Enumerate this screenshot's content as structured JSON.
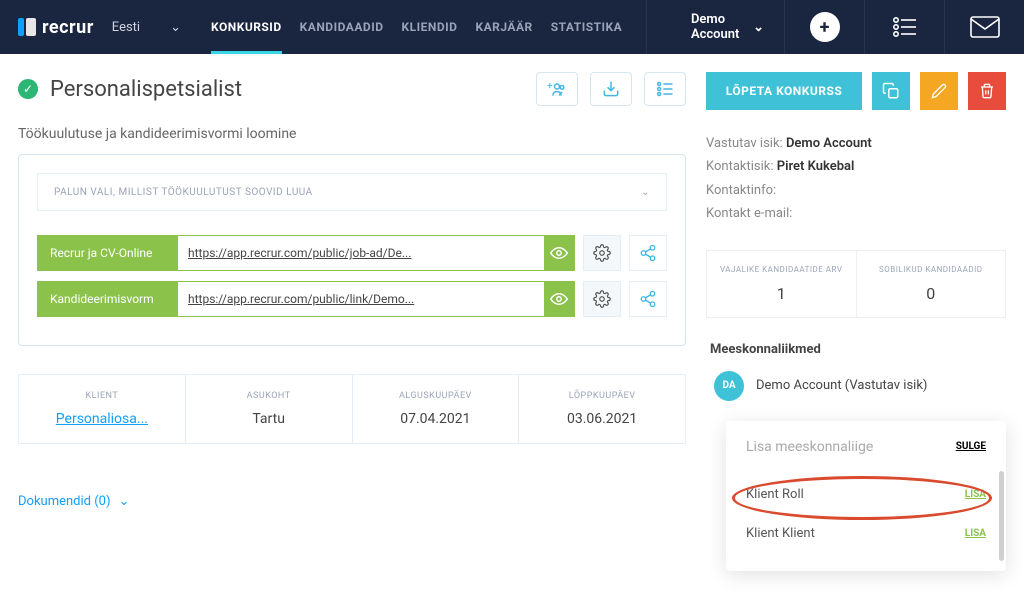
{
  "brand": "recrur",
  "language": "Eesti",
  "nav": {
    "items": [
      "KONKURSID",
      "KANDIDAADID",
      "KLIENDID",
      "KARJÄÄR",
      "STATISTIKA"
    ],
    "active": 0
  },
  "account_name": "Demo Account",
  "page": {
    "title": "Personalispetsialist",
    "section_heading": "Töökuulutuse ja kandideerimisvormi loomine",
    "select_placeholder": "PALUN VALI, MILLIST TÖÖKUULUTUST SOOVID LUUA",
    "links": [
      {
        "label": "Recrur ja CV-Online",
        "url": "https://app.recrur.com/public/job-ad/De..."
      },
      {
        "label": "Kandideerimisvorm",
        "url": "https://app.recrur.com/public/link/Demo..."
      }
    ],
    "info": {
      "klient_label": "KLIENT",
      "klient_value": "Personaliosa...",
      "asukoht_label": "ASUKOHT",
      "asukoht_value": "Tartu",
      "algus_label": "ALGUSKUUPÄEV",
      "algus_value": "07.04.2021",
      "lopp_label": "LÕPPKUUPÄEV",
      "lopp_value": "03.06.2021"
    },
    "documents_label": "Dokumendid (0)"
  },
  "side": {
    "end_competition": "LÕPETA KONKURSS",
    "fields": {
      "vastutav_label": "Vastutav isik:",
      "vastutav_value": "Demo Account",
      "kontaktisik_label": "Kontaktisik:",
      "kontaktisik_value": "Piret Kukebal",
      "kontaktinfo_label": "Kontaktinfo:",
      "kontaktemail_label": "Kontakt e-mail:"
    },
    "stats": {
      "vajalike_label": "VAJALIKE KANDIDAATIDE ARV",
      "vajalike_value": "1",
      "sobilikud_label": "SOBILIKUD KANDIDAADID",
      "sobilikud_value": "0"
    },
    "team_heading": "Meeskonnaliikmed",
    "team_member": {
      "initials": "DA",
      "name": "Demo Account (Vastutav isik)"
    },
    "popup": {
      "title": "Lisa meeskonnaliige",
      "close": "SULGE",
      "add": "LISA",
      "rows": [
        "Klient Roll",
        "Klient Klient"
      ]
    }
  }
}
